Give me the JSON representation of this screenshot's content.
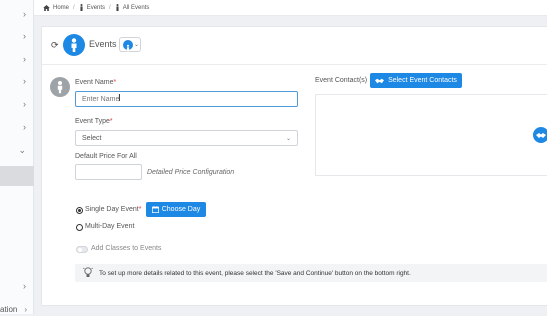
{
  "breadcrumb": {
    "home": "Home",
    "events": "Events",
    "all_events": "All Events",
    "separator": "/"
  },
  "sidebar": {
    "chevron": "›",
    "expanded_chevron": "⌄",
    "last_item_label": "ation"
  },
  "header": {
    "title": "Events",
    "refresh_glyph": "⟳",
    "dropdown_chevron": "⌄"
  },
  "form": {
    "event_name": {
      "label": "Event Name",
      "placeholder": "Enter Name",
      "required_mark": "*"
    },
    "event_type": {
      "label": "Event Type",
      "selected": "Select",
      "required_mark": "*"
    },
    "default_price": {
      "label": "Default Price For All",
      "value": ""
    },
    "detailed_price": "Detailed Price Configuration",
    "event_contacts": {
      "label": "Event Contact(s)",
      "button": "Select Event Contacts"
    },
    "single_day": {
      "label": "Single Day Event",
      "required_mark": "*",
      "selected": true
    },
    "choose_day_button": "Choose Day",
    "multi_day": {
      "label": "Multi-Day Event",
      "selected": false
    },
    "add_classes": {
      "label": "Add Classes to Events",
      "enabled": false
    }
  },
  "info": {
    "text": "To set up more details related to this event, please select the 'Save and Continue' button on the bottom right."
  },
  "colors": {
    "accent": "#1e88e5",
    "required": "#e53935"
  },
  "icons": {
    "home": "home-icon",
    "person": "person-icon",
    "calendar": "calendar-icon",
    "handshake": "handshake-icon",
    "bulb": "lightbulb-icon"
  }
}
